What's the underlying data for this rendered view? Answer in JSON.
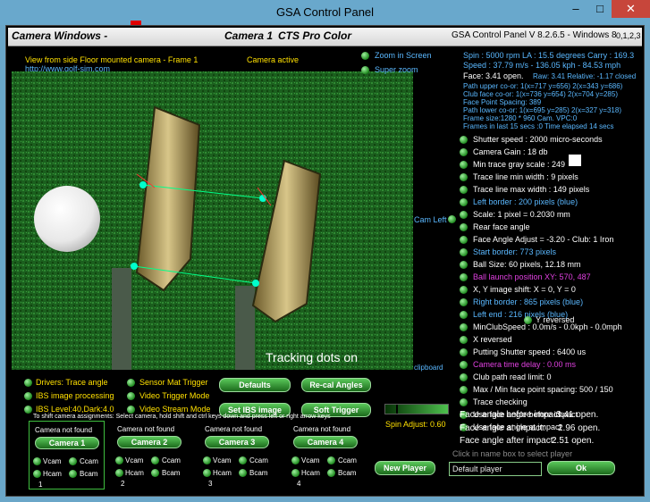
{
  "window": {
    "title": "GSA Control Panel",
    "minimize": "–",
    "maximize": "□",
    "close": "✕"
  },
  "header": {
    "camera_windows": "Camera Windows -",
    "camera": "Camera 1",
    "product": "CTS Pro Color",
    "version": "GSA Control Panel V 8.2.6.5 - Windows 8",
    "channels": "0,1,2,3"
  },
  "camera_view": {
    "caption": "View from side Floor mounted camera -  Frame 1",
    "status": "Camera active",
    "link": "http://www.golf-sim.com",
    "overlay": "Tracking dots  on",
    "clipboard": "clipboard"
  },
  "view_options": {
    "zoom": "Zoom in Screen",
    "super_zoom": "Super zoom"
  },
  "stats": {
    "line1": "Spin : 5000 rpm  LA : 15.5 degrees  Carry : 169.3",
    "line2": "Speed : 37.79 m/s - 136.05 kph - 84.53 mph",
    "face": "Face: 3.41 open.",
    "raw": "Raw: 3.41 Relative: -1.17 closed",
    "details": [
      "Path upper co-or: 1(x=717 y=656) 2(x=343 y=686)",
      "Club face co-or: 1(x=736 y=654) 2(x=704 y=285)",
      "Face Point Spacing: 389",
      "Path lower co-or: 1(x=695 y=285) 2(x=327 y=318)",
      "Frame size:1280 * 960 Cam.  VPC:0",
      "Frames in last 15 secs :0 Time elapsed  14 secs"
    ]
  },
  "settings": [
    {
      "label": "Shutter speed : 2000 micro-seconds",
      "color": "#ffffff"
    },
    {
      "label": "Camera Gain : 18 db",
      "color": "#ffffff"
    },
    {
      "label": "Min trace gray scale : 249",
      "color": "#ffffff"
    },
    {
      "label": "Trace line min width : 9 pixels",
      "color": "#ffffff"
    },
    {
      "label": "Trace line max width : 149 pixels",
      "color": "#ffffff"
    },
    {
      "label": "Left border : 200 pixels (blue)",
      "color": "#5ab8ff"
    },
    {
      "label": "Scale: 1 pixel = 0.2030 mm",
      "color": "#ffffff"
    },
    {
      "label": "Rear face angle",
      "color": "#ffffff"
    },
    {
      "label": "Face Angle Adjust = -3.20 - Club: 1 Iron",
      "color": "#ffffff"
    },
    {
      "label": "Start border: 773 pixels",
      "color": "#5ab8ff"
    },
    {
      "label": "Ball Size: 60 pixels, 12.18 mm",
      "color": "#ffffff"
    },
    {
      "label": "Ball launch position XY: 570, 487",
      "color": "#e040e0"
    },
    {
      "label": "X, Y image shift: X = 0, Y = 0",
      "color": "#ffffff"
    },
    {
      "label": "Right border : 865 pixels (blue)",
      "color": "#5ab8ff"
    },
    {
      "label": "Left end : 216 pixels (blue)",
      "color": "#5ab8ff"
    },
    {
      "label": "MinClubSpeed : 0.0m/s - 0.0kph - 0.0mph",
      "color": "#ffffff"
    },
    {
      "label": "X reversed",
      "color": "#ffffff"
    },
    {
      "label": "Putting Shutter speed : 6400 us",
      "color": "#ffffff"
    },
    {
      "label": "Camera time delay : 0.00 ms",
      "color": "#e040e0"
    },
    {
      "label": "Club path read limit: 0",
      "color": "#ffffff"
    },
    {
      "label": "Max / Min face point spacing: 500 / 150",
      "color": "#ffffff"
    },
    {
      "label": "Trace checking",
      "color": "#ffffff"
    },
    {
      "label": "Use face angle before impact",
      "color": "#ffffff"
    },
    {
      "label": "Use face angle at impact",
      "color": "#ffffff"
    }
  ],
  "cam_left": "Cam Left",
  "y_reversed": "Y reversed",
  "face_angles": {
    "before_label": "Face angle before impact:",
    "before": "3.41 open.",
    "at_label": "Face angle at impact:",
    "at": "2.96 open.",
    "after_label": "Face angle after impact:",
    "after": "2.51 open."
  },
  "options": {
    "drivers_trace": "Drivers: Trace angle",
    "ibs_processing": "IBS image processing",
    "ibs_level": "IBS Level:40,Dark:4.0",
    "sensor_mat": "Sensor Mat Trigger",
    "video_trigger": "Video Trigger Mode",
    "video_stream": "Video Stream Mode"
  },
  "buttons": {
    "defaults": "Defaults",
    "recal": "Re-cal Angles",
    "set_ibs": "Set IBS image",
    "soft_trigger": "Soft Trigger",
    "new_player": "New Player",
    "ok": "Ok"
  },
  "spin_adjust": "Spin Adjust: 0.60",
  "assign_note": "To shift camera assignments: Select camera, hold shift and ctrl keys down and press left or right arrow keys",
  "player": {
    "hint": "Click in name box to select player",
    "name": "Default player"
  },
  "cameras": [
    {
      "status": "Camera not found",
      "name": "Camera 1",
      "v": "Vcam",
      "c": "Ccam",
      "h": "Hcam",
      "b": "Bcam",
      "num": "1"
    },
    {
      "status": "Camera not found",
      "name": "Camera 2",
      "v": "Vcam",
      "c": "Ccam",
      "h": "Hcam",
      "b": "Bcam",
      "num": "2"
    },
    {
      "status": "Camera not found",
      "name": "Camera 3",
      "v": "Vcam",
      "c": "Ccam",
      "h": "Hcam",
      "b": "Bcam",
      "num": "3"
    },
    {
      "status": "Camera not found",
      "name": "Camera 4",
      "v": "Vcam",
      "c": "Ccam",
      "h": "Hcam",
      "b": "Bcam",
      "num": "4"
    }
  ]
}
